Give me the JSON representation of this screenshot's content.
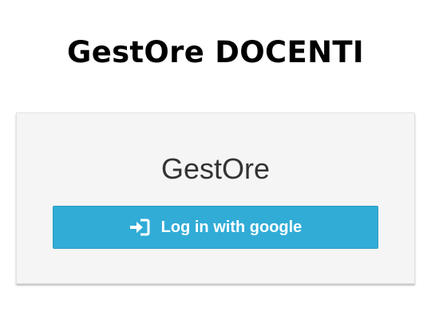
{
  "header": {
    "title": "GestOre DOCENTI"
  },
  "login_card": {
    "title": "GestOre",
    "button": {
      "label": "Log in with google",
      "icon": "sign-in-icon"
    }
  },
  "colors": {
    "button_bg": "#31acd7",
    "card_bg": "#f5f5f5",
    "heading": "#000000",
    "card_title": "#333333"
  }
}
